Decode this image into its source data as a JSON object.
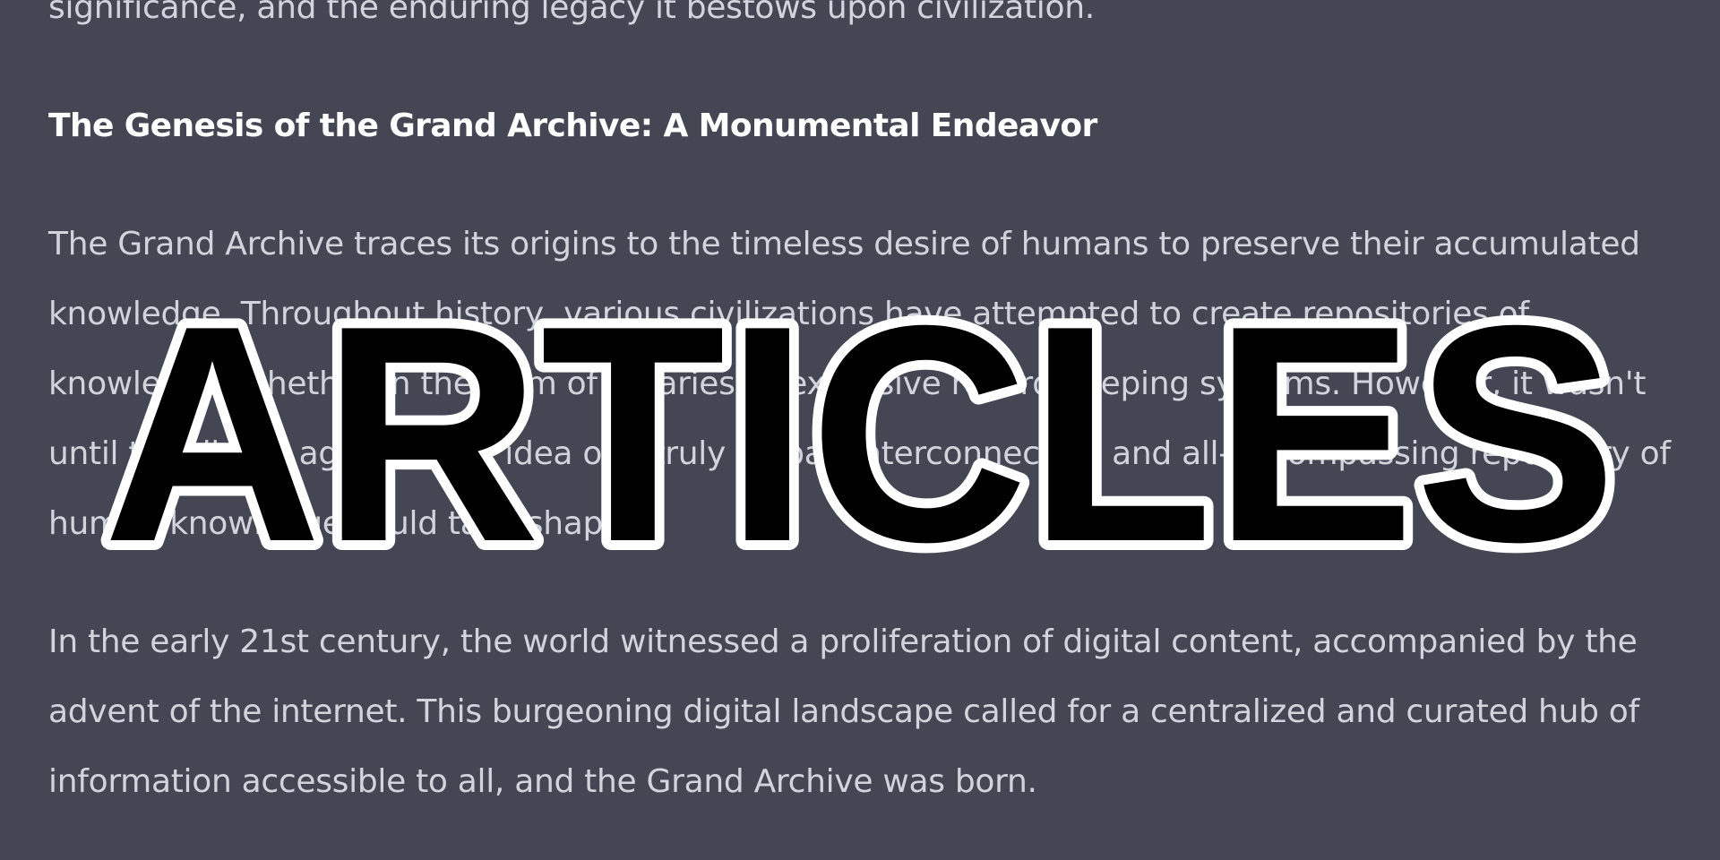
{
  "article": {
    "intro_tail": "significance, and the enduring legacy it bestows upon civilization.",
    "heading": "The Genesis of the Grand Archive: A Monumental Endeavor",
    "paragraph_1": "The Grand Archive traces its origins to the timeless desire of humans to preserve their accumulated knowledge. Throughout history, various civilizations have attempted to create repositories of knowledge, whether in the form of libraries or extensive record-keeping systems. However, it wasn't until the digital age that the idea of a truly global, interconnected, and all-encompassing repository of human knowledge could take shape.",
    "paragraph_2": "In the early 21st century, the world witnessed a proliferation of digital content, accompanied by the advent of the internet. This burgeoning digital landscape called for a centralized and curated hub of information accessible to all, and the Grand Archive was born."
  },
  "overlay": {
    "title": "ARTICLES"
  },
  "colors": {
    "background": "#444654",
    "body_text": "#d1d5db",
    "heading_text": "#ffffff",
    "title_fill": "#000000",
    "title_outline": "#ffffff"
  }
}
